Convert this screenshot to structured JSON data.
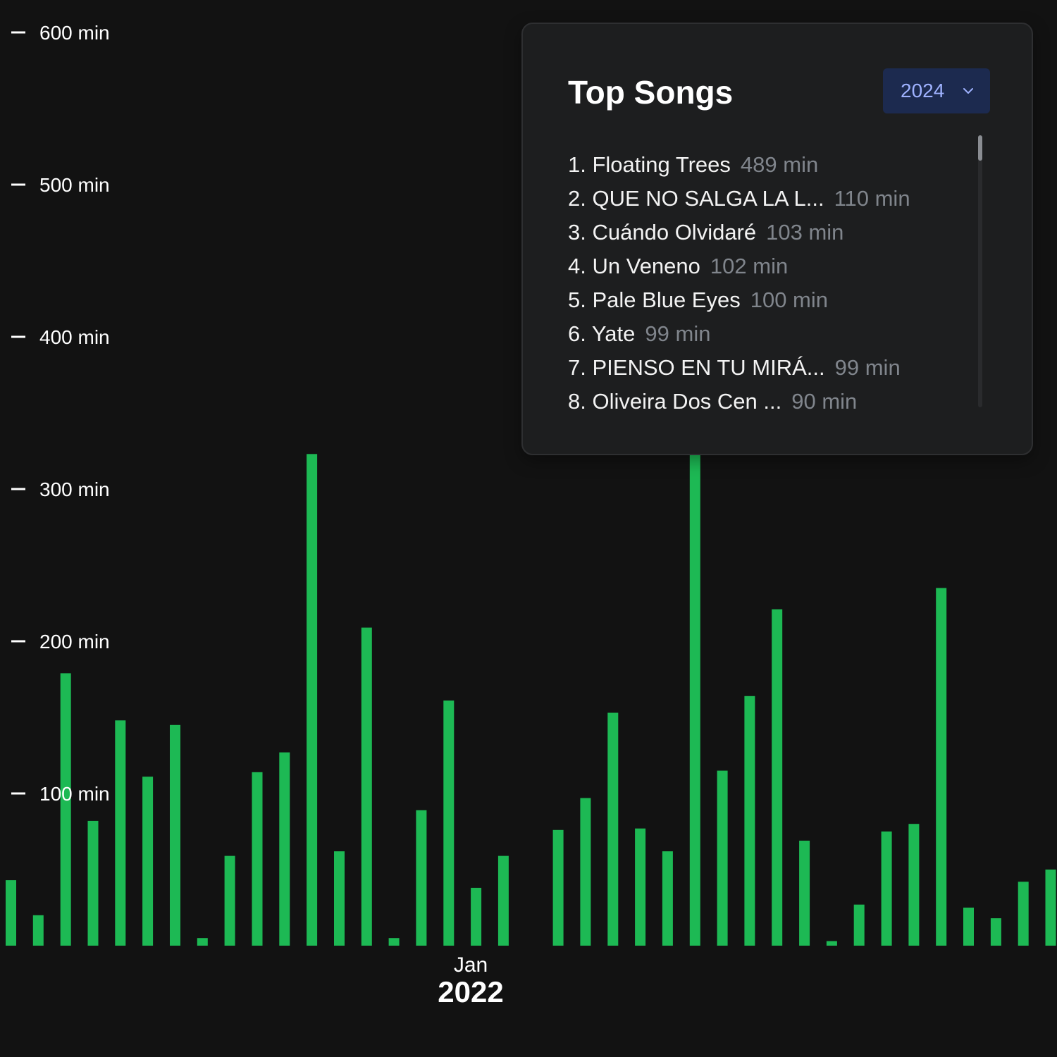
{
  "chart_data": {
    "type": "bar",
    "y_unit_suffix": " min",
    "y_ticks": [
      100,
      200,
      300,
      400,
      500,
      600
    ],
    "y_tick_labels": [
      "100 min",
      "200 min",
      "300 min",
      "400 min",
      "500 min",
      "600 min"
    ],
    "ylim": [
      0,
      625
    ],
    "x_label": {
      "month": "Jan",
      "year": "2022"
    },
    "values": [
      43,
      20,
      179,
      82,
      148,
      111,
      145,
      5,
      59,
      114,
      127,
      323,
      62,
      209,
      5,
      89,
      161,
      38,
      59,
      null,
      76,
      97,
      153,
      77,
      62,
      323,
      115,
      164,
      221,
      69,
      3,
      27,
      75,
      80,
      235,
      25,
      18,
      42,
      50
    ],
    "bar_color": "#1db954",
    "grid": false,
    "legend": "none"
  },
  "panel": {
    "title": "Top Songs",
    "year_selected": "2024",
    "songs": [
      {
        "rank": "1.",
        "title": "Floating Trees",
        "minutes": "489 min"
      },
      {
        "rank": "2.",
        "title": "QUE NO SALGA LA L...",
        "minutes": "110 min"
      },
      {
        "rank": "3.",
        "title": "Cuándo Olvidaré",
        "minutes": "103 min"
      },
      {
        "rank": "4.",
        "title": "Un Veneno",
        "minutes": "102 min"
      },
      {
        "rank": "5.",
        "title": "Pale Blue Eyes",
        "minutes": "100 min"
      },
      {
        "rank": "6.",
        "title": "Yate",
        "minutes": "99 min"
      },
      {
        "rank": "7.",
        "title": "PIENSO EN TU MIRÁ...",
        "minutes": "99 min"
      },
      {
        "rank": "8.",
        "title": "Oliveira Dos Cen ...",
        "minutes": "90 min"
      }
    ]
  },
  "colors": {
    "background": "#121212",
    "bar": "#1db954",
    "panel_bg": "#1e1f20",
    "select_bg": "#1c2a4f",
    "select_text": "#9fb2ff",
    "muted_text": "#80858c"
  },
  "icons": {
    "dropdown": "chevron-down-icon"
  }
}
